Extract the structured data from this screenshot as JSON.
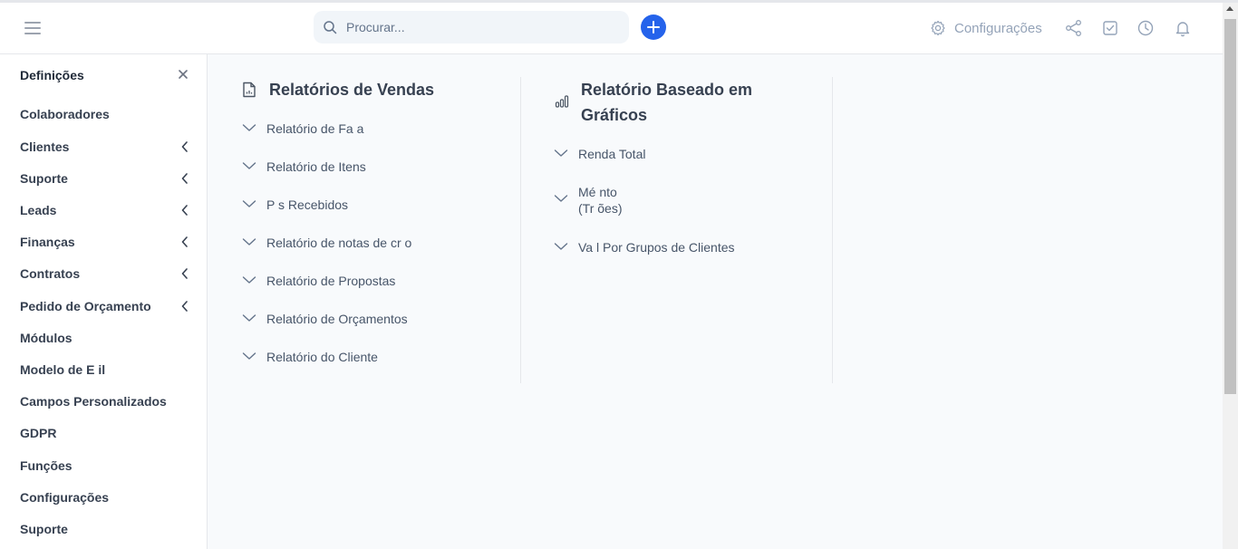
{
  "header": {
    "search_placeholder": "Procurar...",
    "settings_label": "Configurações",
    "icons": [
      "menu-icon",
      "search-icon",
      "plus-icon",
      "gear-icon",
      "share-icon",
      "checkbox-icon",
      "clock-icon",
      "bell-icon"
    ],
    "accent_color": "#2563eb"
  },
  "sidebar": {
    "title": "Definições",
    "items": [
      {
        "label": "Colaboradores",
        "has_submenu": false
      },
      {
        "label": "Clientes",
        "has_submenu": true
      },
      {
        "label": "Suporte",
        "has_submenu": true
      },
      {
        "label": "Leads",
        "has_submenu": true
      },
      {
        "label": "Finanças",
        "has_submenu": true
      },
      {
        "label": "Contratos",
        "has_submenu": true
      },
      {
        "label": "Pedido de Orçamento",
        "has_submenu": true
      },
      {
        "label": "Módulos",
        "has_submenu": false
      },
      {
        "label": "Modelo de E il",
        "has_submenu": false
      },
      {
        "label": "Campos Personalizados",
        "has_submenu": false
      },
      {
        "label": "GDPR",
        "has_submenu": false
      },
      {
        "label": "Funções",
        "has_submenu": false
      },
      {
        "label": "Configurações",
        "has_submenu": false
      },
      {
        "label": "Suporte",
        "has_submenu": false
      }
    ]
  },
  "sales_reports": {
    "title": "Relatórios de Vendas",
    "items": [
      "Relatório de Fa a",
      "Relatório de Itens",
      "P s Recebidos",
      "Relatório de notas de cr o",
      "Relatório de Propostas",
      "Relatório de Orçamentos",
      "Relatório do Cliente"
    ]
  },
  "chart_reports": {
    "title_line1": "Relatório Baseado em",
    "title_line2": "Gráficos",
    "items": [
      {
        "line1": "Renda Total",
        "line2": ""
      },
      {
        "line1": "Mé nto",
        "line2": "(Tr ões)"
      },
      {
        "line1": "Va l Por Grupos de Clientes",
        "line2": ""
      }
    ]
  }
}
